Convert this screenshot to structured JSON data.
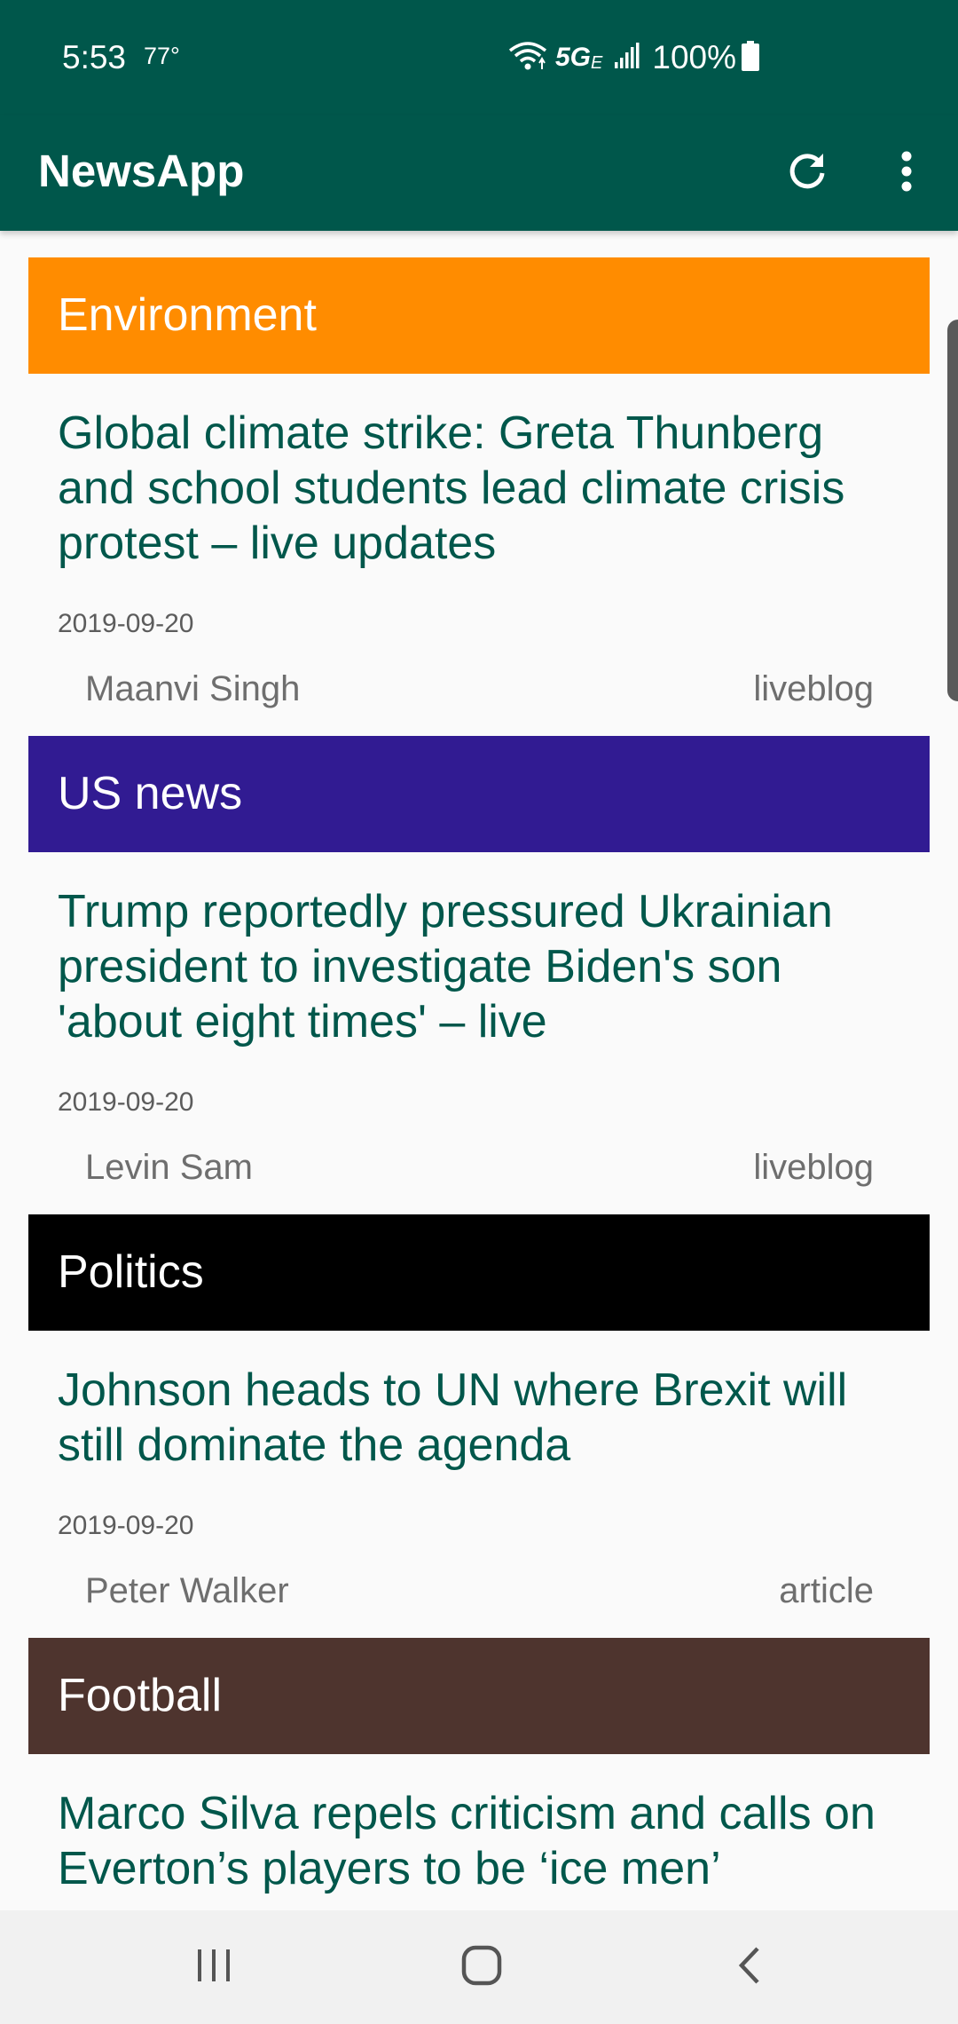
{
  "status_bar": {
    "time": "5:53",
    "temperature": "77°",
    "network": "5G",
    "network_suffix": "E",
    "battery": "100%"
  },
  "app_bar": {
    "title": "NewsApp",
    "actions": [
      "refresh-icon",
      "more-vert-icon"
    ]
  },
  "articles": [
    {
      "section": "Environment",
      "section_color": "#ff8c00",
      "title": "Global climate strike: Greta Thunberg and school students lead climate crisis protest – live updates",
      "date": "2019-09-20",
      "author": "Maanvi Singh",
      "type": "liveblog"
    },
    {
      "section": "US news",
      "section_color": "#311b92",
      "title": "Trump reportedly pressured Ukrainian president to investigate Biden's son 'about eight times' – live",
      "date": "2019-09-20",
      "author": "Levin Sam",
      "type": "liveblog"
    },
    {
      "section": "Politics",
      "section_color": "#000000",
      "title": "Johnson heads to UN where Brexit will still dominate the agenda",
      "date": "2019-09-20",
      "author": "Peter Walker",
      "type": "article"
    },
    {
      "section": "Football",
      "section_color": "#4e342e",
      "title": "Marco Silva repels criticism and calls on Everton’s players to be ‘ice men’"
    }
  ],
  "nav_bar": {
    "buttons": [
      "recent-apps-icon",
      "home-icon",
      "back-icon"
    ]
  },
  "colors": {
    "primary": "#00574b",
    "title_text": "#00574b"
  }
}
